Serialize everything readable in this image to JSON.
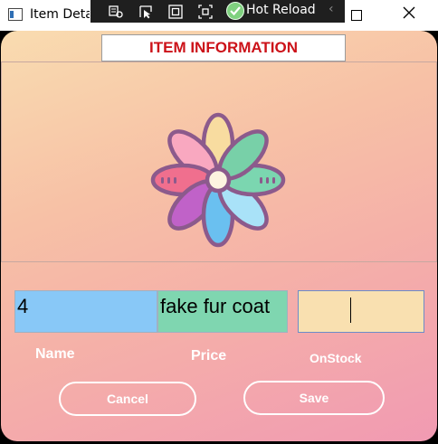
{
  "window": {
    "title": "Item Deta"
  },
  "devtools": {
    "hot_reload_label": "Hot Reload"
  },
  "form": {
    "heading": "ITEM INFORMATION",
    "name_value": "4",
    "price_value": "fake fur coat",
    "stock_value": "",
    "labels": {
      "name": "Name",
      "price": "Price",
      "stock": "OnStock"
    }
  },
  "buttons": {
    "cancel": "Cancel",
    "save": "Save"
  },
  "colors": {
    "heading": "#cc1219",
    "name_field": "#88c8f7",
    "price_field": "#7fd6b0",
    "stock_field": "#f9e0b0"
  },
  "icons": [
    "app-icon",
    "live-visual-tree-icon",
    "select-element-icon",
    "display-layout-adorners-icon",
    "track-focus-icon",
    "hot-reload-check-icon",
    "chevron-left-icon",
    "maximize-icon",
    "close-icon",
    "flower-image"
  ]
}
